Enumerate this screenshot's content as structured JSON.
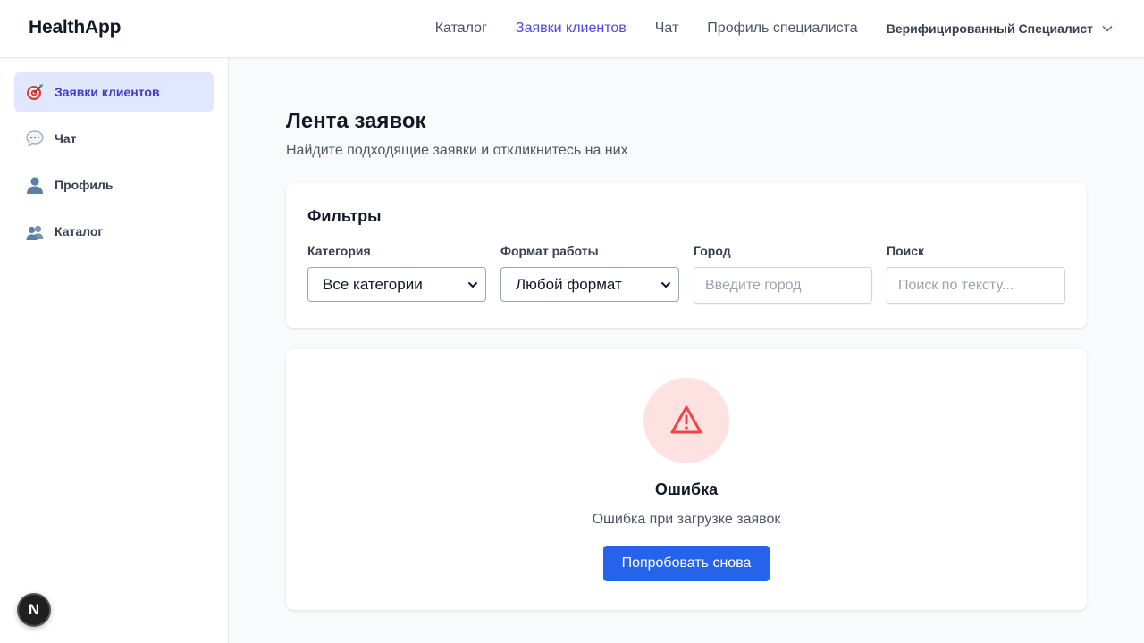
{
  "app": {
    "title": "HealthApp"
  },
  "topnav": {
    "items": [
      {
        "label": "Каталог",
        "active": false
      },
      {
        "label": "Заявки клиентов",
        "active": true
      },
      {
        "label": "Чат",
        "active": false
      },
      {
        "label": "Профиль специалиста",
        "active": false
      }
    ],
    "user": {
      "label": "Верифицированный Специалист",
      "icon": "chevron-down-icon"
    }
  },
  "sidebar": {
    "items": [
      {
        "label": "Заявки клиентов",
        "icon": "target-icon",
        "active": true
      },
      {
        "label": "Чат",
        "icon": "speech-bubble-icon",
        "active": false
      },
      {
        "label": "Профиль",
        "icon": "user-icon",
        "active": false
      },
      {
        "label": "Каталог",
        "icon": "users-icon",
        "active": false
      }
    ]
  },
  "page": {
    "title": "Лента заявок",
    "subtitle": "Найдите подходящие заявки и откликнитесь на них"
  },
  "filters": {
    "title": "Фильтры",
    "category": {
      "label": "Категория",
      "value": "Все категории"
    },
    "format": {
      "label": "Формат работы",
      "value": "Любой формат"
    },
    "city": {
      "label": "Город",
      "placeholder": "Введите город"
    },
    "search": {
      "label": "Поиск",
      "placeholder": "Поиск по тексту..."
    }
  },
  "error": {
    "icon": "warning-icon",
    "title": "Ошибка",
    "message": "Ошибка при загрузке заявок",
    "retry_label": "Попробовать снова"
  },
  "badge": {
    "label": "N"
  },
  "colors": {
    "accent": "#4f46e5",
    "accent_bg": "#e0e7ff",
    "button": "#2563eb",
    "error": "#ef4444",
    "error_bg": "#fee2e2"
  }
}
